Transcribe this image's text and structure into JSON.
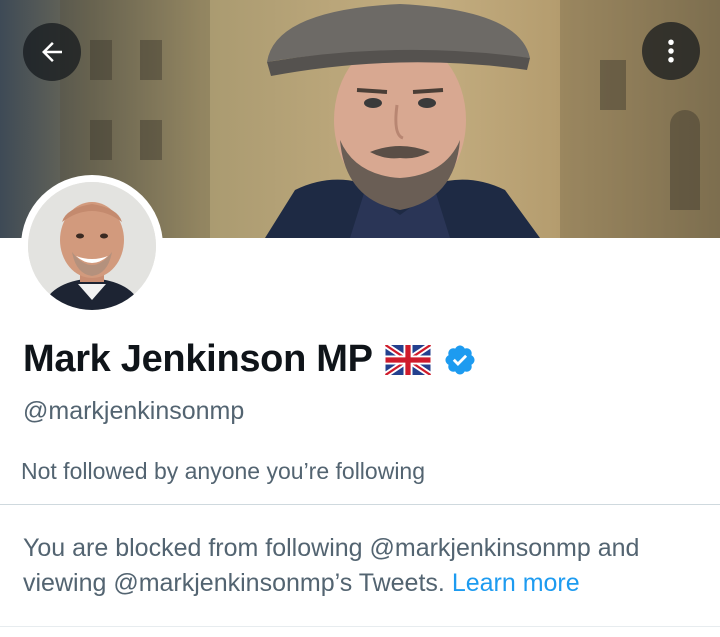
{
  "header": {
    "back_icon": "arrow-left-icon",
    "more_icon": "more-vertical-icon"
  },
  "profile": {
    "name": "Mark Jenkinson MP",
    "flag_icon": "uk-flag-emoji",
    "verified_icon": "verified-badge-icon",
    "handle": "@markjenkinsonmp",
    "followers_note": "Not followed by anyone you’re following"
  },
  "blocked_notice": {
    "text": "You are blocked from following @markjenkinsonmp and viewing @markjenkinsonmp’s Tweets.",
    "link": "Learn more"
  },
  "colors": {
    "link": "#1d9bf0",
    "secondary_text": "#536471",
    "primary_text": "#0f1419",
    "verified": "#1d9bf0"
  }
}
